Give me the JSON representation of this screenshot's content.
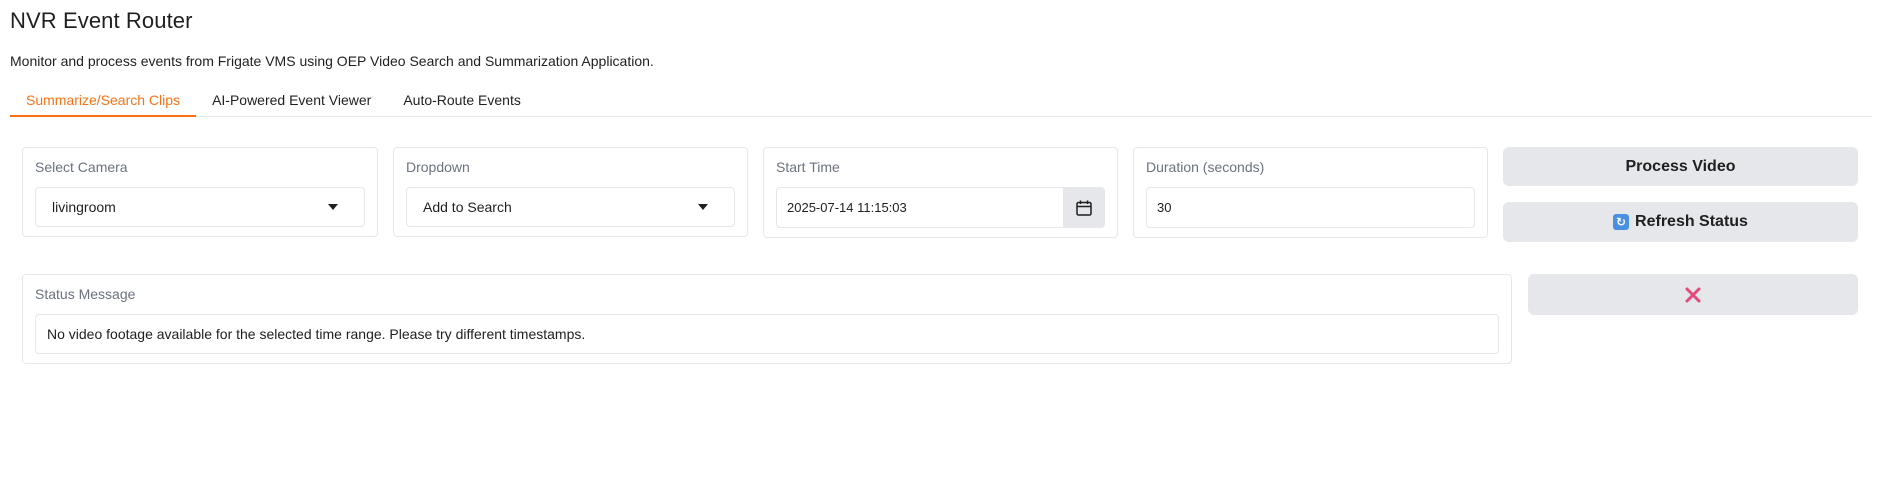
{
  "app": {
    "title": "NVR Event Router",
    "subtitle": "Monitor and process events from Frigate VMS using OEP Video Search and Summarization Application."
  },
  "tabs": [
    {
      "label": "Summarize/Search Clips",
      "active": true
    },
    {
      "label": "AI-Powered Event Viewer",
      "active": false
    },
    {
      "label": "Auto-Route Events",
      "active": false
    }
  ],
  "camera": {
    "label": "Select Camera",
    "value": "livingroom"
  },
  "dropdown": {
    "label": "Dropdown",
    "value": "Add to Search"
  },
  "start_time": {
    "label": "Start Time",
    "value": "2025-07-14 11:15:03"
  },
  "duration": {
    "label": "Duration (seconds)",
    "value": "30"
  },
  "buttons": {
    "process_video": "Process Video",
    "refresh_status": "Refresh Status",
    "refresh_icon": "arrows-refresh-icon",
    "close_icon": "cross-mark-icon"
  },
  "status": {
    "label": "Status Message",
    "message": "No video footage available for the selected time range. Please try different timestamps."
  },
  "colors": {
    "accent": "#f97316",
    "close": "#e5497a",
    "button_bg": "#e5e7eb"
  }
}
